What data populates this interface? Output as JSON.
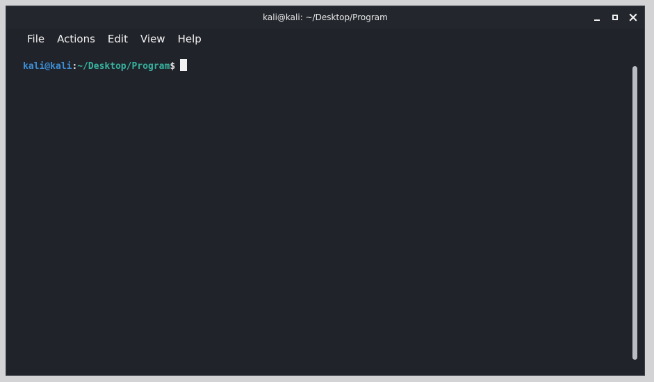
{
  "window": {
    "title": "kali@kali: ~/Desktop/Program"
  },
  "menu": {
    "items": [
      {
        "label": "File"
      },
      {
        "label": "Actions"
      },
      {
        "label": "Edit"
      },
      {
        "label": "View"
      },
      {
        "label": "Help"
      }
    ]
  },
  "terminal": {
    "prompt_user": "kali@kali",
    "prompt_sep": ":",
    "prompt_path": "~/Desktop/Program",
    "prompt_symbol": "$"
  },
  "colors": {
    "background": "#20232a",
    "prompt_user": "#3d8fd6",
    "prompt_path": "#37b3a0",
    "text": "#f2f2f2"
  },
  "icons": {
    "minimize": "minimize-icon",
    "maximize": "maximize-icon",
    "close": "close-icon"
  }
}
